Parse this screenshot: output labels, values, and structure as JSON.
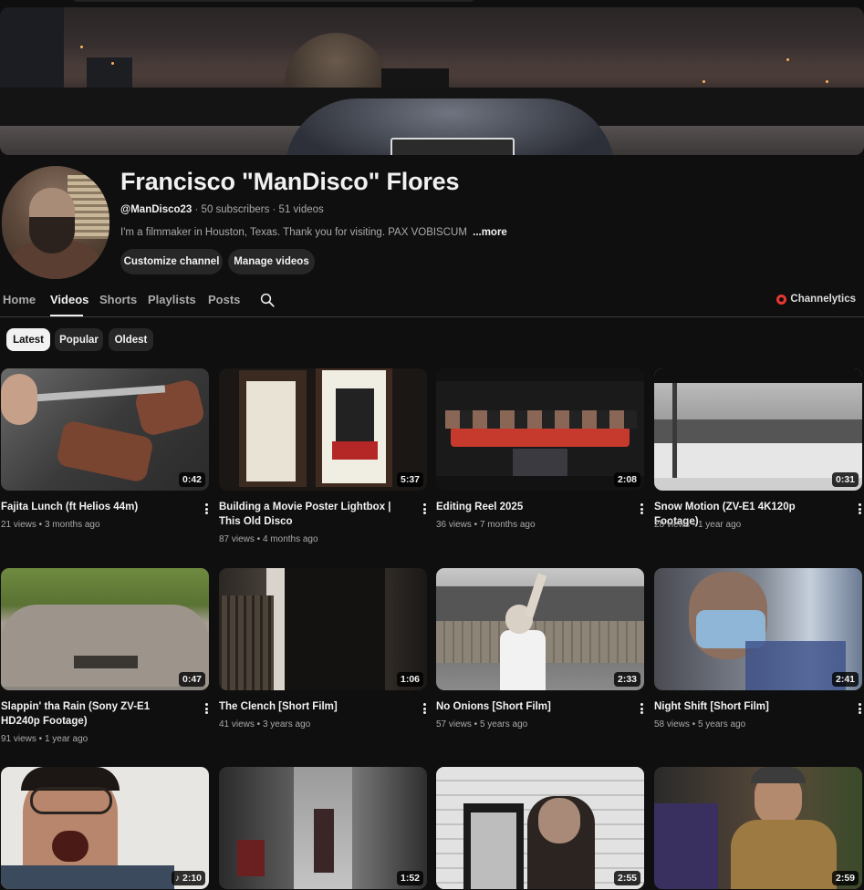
{
  "channel": {
    "name": "Francisco \"ManDisco\" Flores",
    "handle": "@ManDisco23",
    "meta_rest": " · 50 subscribers · 51 videos",
    "description": "I'm a filmmaker in Houston, Texas. Thank you for visiting. PAX VOBISCUM",
    "more_label": "...more",
    "customize_label": "Customize channel",
    "manage_label": "Manage videos"
  },
  "tabs": [
    {
      "label": "Home"
    },
    {
      "label": "Videos"
    },
    {
      "label": "Shorts"
    },
    {
      "label": "Playlists"
    },
    {
      "label": "Posts"
    }
  ],
  "extension": {
    "label": "Channelytics"
  },
  "chips": [
    {
      "label": "Latest"
    },
    {
      "label": "Popular"
    },
    {
      "label": "Oldest"
    }
  ],
  "videos": [
    {
      "title": "Fajita Lunch (ft Helios 44m)",
      "meta": "21 views • 3 months ago",
      "duration": "0:42"
    },
    {
      "title": "Building a Movie Poster Lightbox | This Old Disco",
      "meta": "87 views • 4 months ago",
      "duration": "5:37"
    },
    {
      "title": "Editing Reel 2025",
      "meta": "36 views • 7 months ago",
      "duration": "2:08"
    },
    {
      "title": "Snow Motion (ZV-E1 4K120p Footage)",
      "meta": "28 views • 1 year ago",
      "duration": "0:31"
    },
    {
      "title": "Slappin' tha Rain (Sony ZV-E1 HD240p Footage)",
      "meta": "91 views • 1 year ago",
      "duration": "0:47"
    },
    {
      "title": "The Clench [Short Film]",
      "meta": "41 views • 3 years ago",
      "duration": "1:06"
    },
    {
      "title": "No Onions [Short Film]",
      "meta": "57 views • 5 years ago",
      "duration": "2:33"
    },
    {
      "title": "Night Shift [Short Film]",
      "meta": "58 views • 5 years ago",
      "duration": "2:41"
    },
    {
      "duration": "♪ 2:10"
    },
    {
      "duration": "1:52"
    },
    {
      "duration": "2:55"
    },
    {
      "duration": "2:59"
    }
  ]
}
